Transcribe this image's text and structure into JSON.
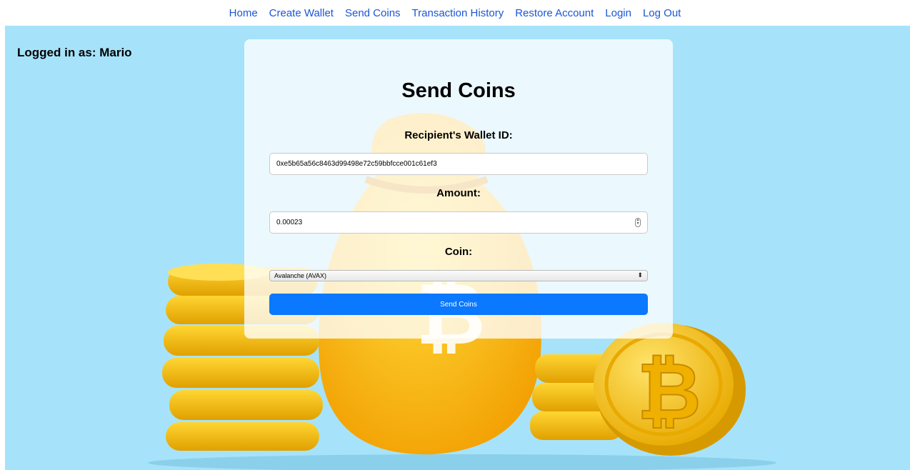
{
  "nav": {
    "items": [
      "Home",
      "Create Wallet",
      "Send Coins",
      "Transaction History",
      "Restore Account",
      "Login",
      "Log Out"
    ]
  },
  "user": {
    "logged_in_text": "Logged in as: Mario"
  },
  "form": {
    "title": "Send Coins",
    "recipient_label": "Recipient's Wallet ID:",
    "recipient_value": "0xe5b65a56c8463d99498e72c59bbfcce001c61ef3",
    "amount_label": "Amount:",
    "amount_value": "0.00023",
    "coin_label": "Coin:",
    "coin_selected": "Avalanche (AVAX)",
    "submit_label": "Send Coins"
  },
  "colors": {
    "background": "#a6e3fa",
    "link": "#1a56d6",
    "button": "#0a78ff",
    "coin": "#f5b800"
  }
}
